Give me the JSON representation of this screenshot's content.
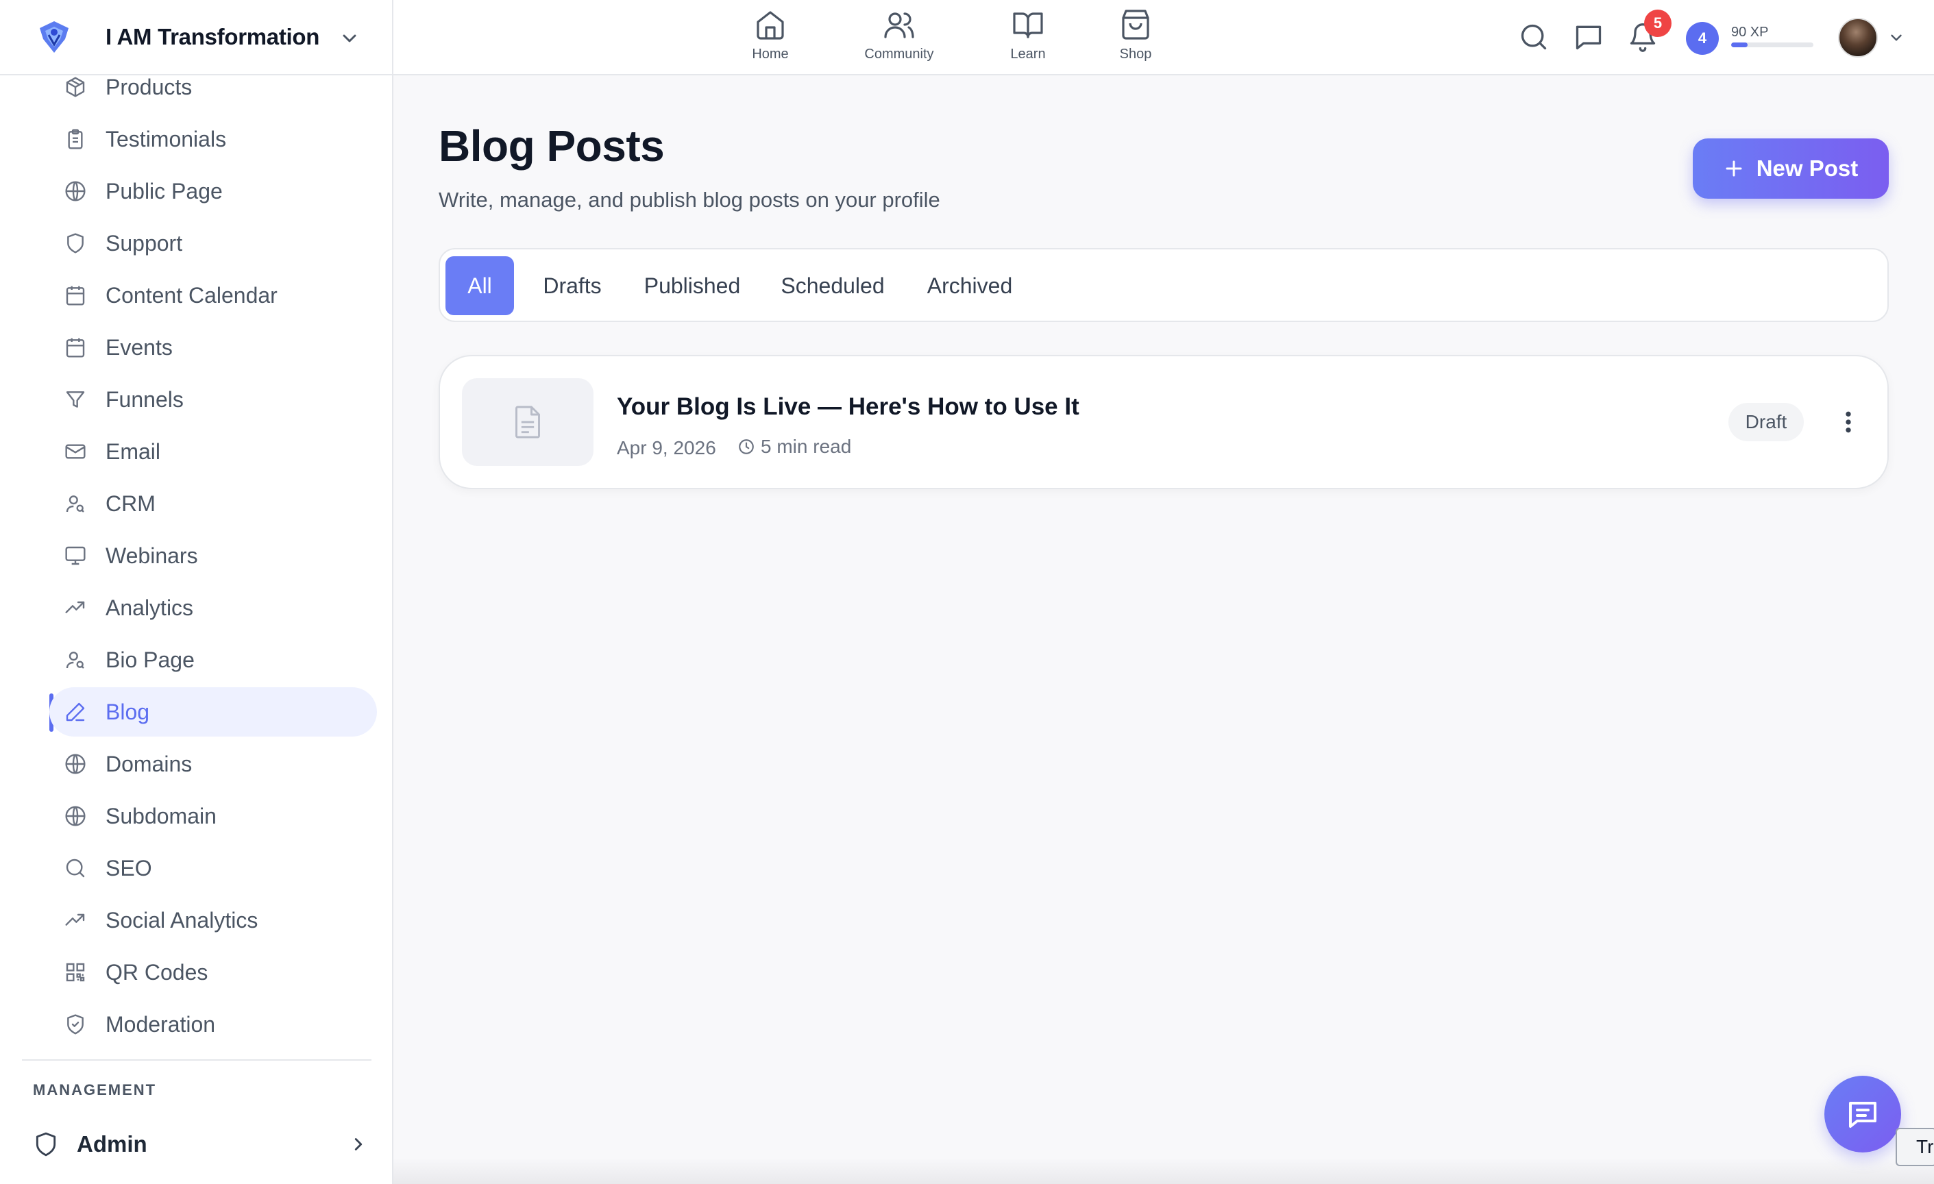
{
  "workspace": {
    "name": "I AM Transformation"
  },
  "sidebar": {
    "items": [
      {
        "label": "Products",
        "icon": "box-icon"
      },
      {
        "label": "Testimonials",
        "icon": "clipboard-icon"
      },
      {
        "label": "Public Page",
        "icon": "globe-icon"
      },
      {
        "label": "Support",
        "icon": "shield-icon"
      },
      {
        "label": "Content Calendar",
        "icon": "calendar-icon"
      },
      {
        "label": "Events",
        "icon": "calendar-icon"
      },
      {
        "label": "Funnels",
        "icon": "funnel-icon"
      },
      {
        "label": "Email",
        "icon": "mail-icon"
      },
      {
        "label": "CRM",
        "icon": "user-search-icon"
      },
      {
        "label": "Webinars",
        "icon": "monitor-icon"
      },
      {
        "label": "Analytics",
        "icon": "trending-up-icon"
      },
      {
        "label": "Bio Page",
        "icon": "user-search-icon"
      },
      {
        "label": "Blog",
        "icon": "pen-icon",
        "active": true
      },
      {
        "label": "Domains",
        "icon": "globe-icon"
      },
      {
        "label": "Subdomain",
        "icon": "globe-icon"
      },
      {
        "label": "SEO",
        "icon": "search-icon"
      },
      {
        "label": "Social Analytics",
        "icon": "trending-up-icon"
      },
      {
        "label": "QR Codes",
        "icon": "qr-code-icon"
      },
      {
        "label": "Moderation",
        "icon": "shield-check-icon"
      }
    ],
    "management_label": "MANAGEMENT",
    "admin_label": "Admin"
  },
  "topnav": {
    "items": [
      {
        "label": "Home",
        "icon": "home-icon"
      },
      {
        "label": "Community",
        "icon": "users-icon"
      },
      {
        "label": "Learn",
        "icon": "book-icon"
      },
      {
        "label": "Shop",
        "icon": "shopping-bag-icon"
      }
    ],
    "notification_count": "5",
    "level": "4",
    "xp_label": "90 XP",
    "xp_progress": 0.2
  },
  "main": {
    "title": "Blog Posts",
    "subtitle": "Write, manage, and publish blog posts on your profile",
    "new_post_label": "New Post",
    "tabs": [
      {
        "label": "All",
        "active": true
      },
      {
        "label": "Drafts"
      },
      {
        "label": "Published"
      },
      {
        "label": "Scheduled"
      },
      {
        "label": "Archived"
      }
    ],
    "posts": [
      {
        "title": "Your Blog Is Live — Here's How to Use It",
        "date": "Apr 9, 2026",
        "read_time": "5 min read",
        "status": "Draft"
      }
    ]
  },
  "floating": {
    "tr_chip": "Tr"
  },
  "colors": {
    "accent": "#5b6df0",
    "badge": "#ef4444",
    "sidebar_active_bg": "#eef1ff"
  }
}
